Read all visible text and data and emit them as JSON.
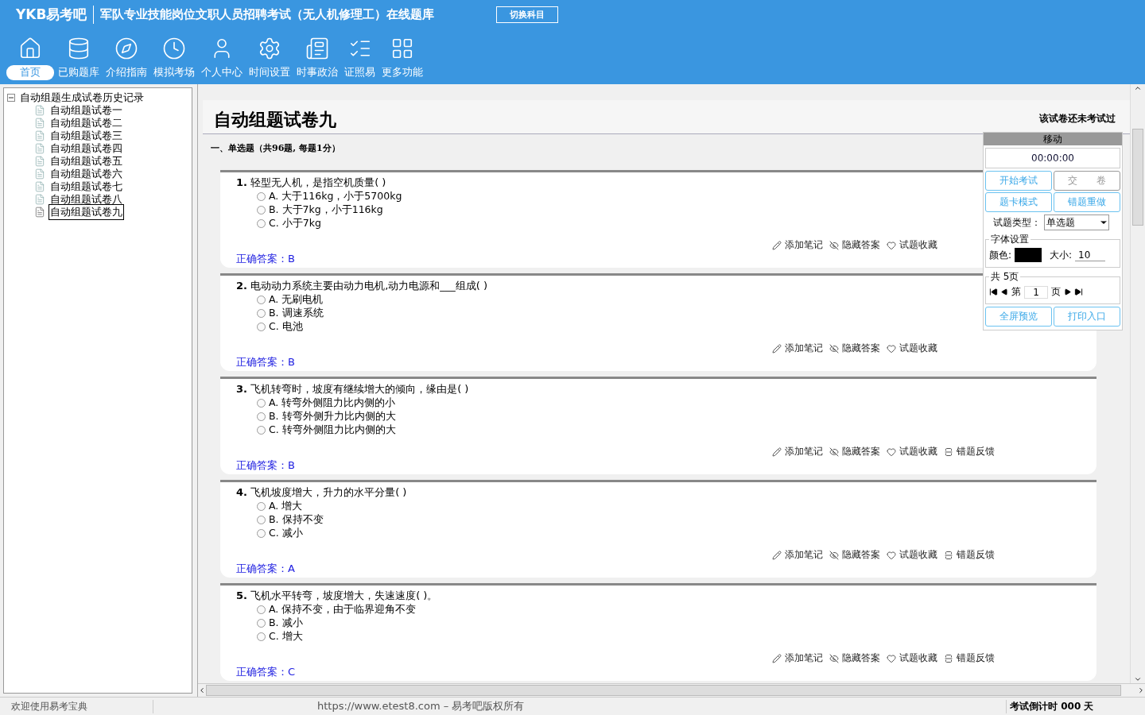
{
  "header": {
    "logo": "YKB易考吧",
    "title": "军队专业技能岗位文职人员招聘考试（无人机修理工）在线题库",
    "switch_button": "切换科目"
  },
  "nav": [
    {
      "label": "首页",
      "selected": true
    },
    {
      "label": "已购题库",
      "selected": false
    },
    {
      "label": "介绍指南",
      "selected": false
    },
    {
      "label": "模拟考场",
      "selected": false
    },
    {
      "label": "个人中心",
      "selected": false
    },
    {
      "label": "时间设置",
      "selected": false
    },
    {
      "label": "时事政治",
      "selected": false
    },
    {
      "label": "证照易",
      "selected": false
    },
    {
      "label": "更多功能",
      "selected": false
    }
  ],
  "tree": {
    "label": "自动组题生成试卷历史记录",
    "expanded": true,
    "children": [
      {
        "label": "自动组题试卷一",
        "selected": false
      },
      {
        "label": "自动组题试卷二",
        "selected": false
      },
      {
        "label": "自动组题试卷三",
        "selected": false
      },
      {
        "label": "自动组题试卷四",
        "selected": false
      },
      {
        "label": "自动组题试卷五",
        "selected": false
      },
      {
        "label": "自动组题试卷六",
        "selected": false
      },
      {
        "label": "自动组题试卷七",
        "selected": false
      },
      {
        "label": "自动组题试卷八",
        "selected": false
      },
      {
        "label": "自动组题试卷九",
        "selected": true
      }
    ]
  },
  "paper": {
    "title": "自动组题试卷九",
    "status": "该试卷还未考试过",
    "section": "一、单选题（共96题, 每题1分）"
  },
  "questions": [
    {
      "number": "1.",
      "text": "轻型无人机，是指空机质量( )",
      "options": [
        {
          "letter": "A.",
          "text": "大于116kg，小于5700kg",
          "selected": false
        },
        {
          "letter": "B.",
          "text": "大于7kg，小于116kg",
          "selected": false
        },
        {
          "letter": "C.",
          "text": "小于7kg",
          "selected": false
        }
      ],
      "answer_label": "正确答案：",
      "answer": "B",
      "actions": [
        {
          "kind": "note",
          "label": "添加笔记"
        },
        {
          "kind": "hide",
          "label": "隐藏答案"
        },
        {
          "kind": "favorite",
          "label": "试题收藏"
        }
      ]
    },
    {
      "number": "2.",
      "text": "电动动力系统主要由动力电机,动力电源和___组成( )",
      "options": [
        {
          "letter": "A.",
          "text": "无刷电机",
          "selected": false
        },
        {
          "letter": "B.",
          "text": "调速系统",
          "selected": false
        },
        {
          "letter": "C.",
          "text": "电池",
          "selected": false
        }
      ],
      "answer_label": "正确答案：",
      "answer": "B",
      "actions": [
        {
          "kind": "note",
          "label": "添加笔记"
        },
        {
          "kind": "hide",
          "label": "隐藏答案"
        },
        {
          "kind": "favorite",
          "label": "试题收藏"
        }
      ]
    },
    {
      "number": "3.",
      "text": "飞机转弯时，坡度有继续增大的倾向，缘由是( )",
      "options": [
        {
          "letter": "A.",
          "text": "转弯外侧阻力比内侧的小",
          "selected": false
        },
        {
          "letter": "B.",
          "text": "转弯外侧升力比内侧的大",
          "selected": false
        },
        {
          "letter": "C.",
          "text": "转弯外侧阻力比内侧的大",
          "selected": false
        }
      ],
      "answer_label": "正确答案：",
      "answer": "B",
      "actions": [
        {
          "kind": "note",
          "label": "添加笔记"
        },
        {
          "kind": "hide",
          "label": "隐藏答案"
        },
        {
          "kind": "favorite",
          "label": "试题收藏"
        },
        {
          "kind": "feedback",
          "label": "错题反馈"
        }
      ]
    },
    {
      "number": "4.",
      "text": "飞机坡度增大，升力的水平分量( )",
      "options": [
        {
          "letter": "A.",
          "text": "增大",
          "selected": false
        },
        {
          "letter": "B.",
          "text": "保持不变",
          "selected": false
        },
        {
          "letter": "C.",
          "text": "减小",
          "selected": false
        }
      ],
      "answer_label": "正确答案：",
      "answer": "A",
      "actions": [
        {
          "kind": "note",
          "label": "添加笔记"
        },
        {
          "kind": "hide",
          "label": "隐藏答案"
        },
        {
          "kind": "favorite",
          "label": "试题收藏"
        },
        {
          "kind": "feedback",
          "label": "错题反馈"
        }
      ]
    },
    {
      "number": "5.",
      "text": "飞机水平转弯，坡度增大，失速速度( )。",
      "options": [
        {
          "letter": "A.",
          "text": "保持不变，由于临界迎角不变",
          "selected": false
        },
        {
          "letter": "B.",
          "text": "减小",
          "selected": false
        },
        {
          "letter": "C.",
          "text": "增大",
          "selected": false
        }
      ],
      "answer_label": "正确答案：",
      "answer": "C",
      "actions": [
        {
          "kind": "note",
          "label": "添加笔记"
        },
        {
          "kind": "hide",
          "label": "隐藏答案"
        },
        {
          "kind": "favorite",
          "label": "试题收藏"
        },
        {
          "kind": "feedback",
          "label": "错题反馈"
        }
      ]
    }
  ],
  "panel": {
    "move": "移动",
    "timer": "00:00:00",
    "buttons": [
      {
        "label": "开始考试",
        "disabled": false
      },
      {
        "label": "交　　卷",
        "disabled": true
      },
      {
        "label": "题卡模式",
        "disabled": false
      },
      {
        "label": "错题重做",
        "disabled": false
      }
    ],
    "type_label": "试题类型：",
    "type_value": "单选题",
    "font_legend": "字体设置",
    "color_label": "颜色:",
    "size_label": "大小:",
    "size": "10",
    "pages_legend": "共 5页",
    "page_prefix": "第",
    "page": "1",
    "page_suffix": "页",
    "bottom_buttons": [
      {
        "label": "全屏预览"
      },
      {
        "label": "打印入口"
      }
    ]
  },
  "status": {
    "welcome": "欢迎使用易考宝典",
    "copyright": "https://www.etest8.com – 易考吧版权所有",
    "countdown": "考试倒计时 000 天"
  }
}
